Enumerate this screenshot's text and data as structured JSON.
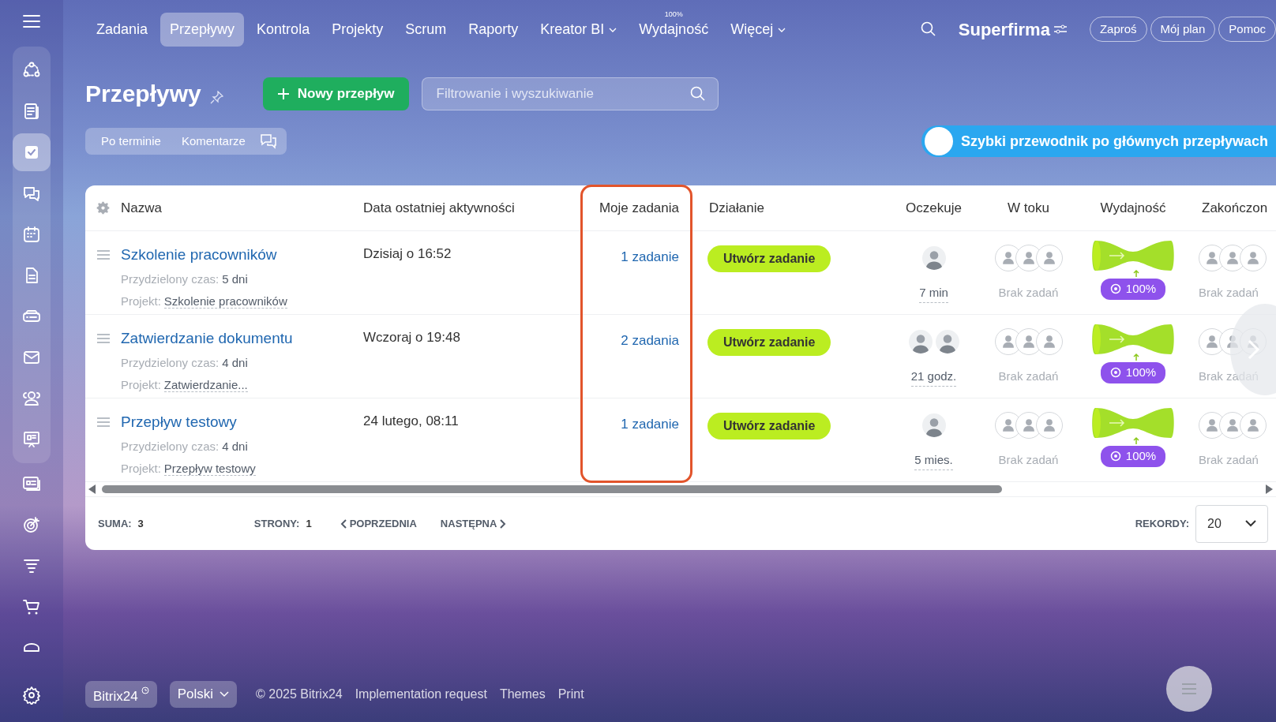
{
  "sidebar": {
    "items": [
      {
        "selected": false
      },
      {
        "selected": false
      },
      {
        "selected": true
      },
      {
        "selected": false
      },
      {
        "selected": false
      },
      {
        "selected": false
      },
      {
        "selected": false
      },
      {
        "selected": false
      },
      {
        "selected": false
      },
      {
        "selected": false
      },
      {
        "selected": false
      },
      {
        "selected": false
      },
      {
        "selected": false
      },
      {
        "selected": false
      },
      {
        "selected": false
      }
    ]
  },
  "nav": {
    "items": [
      {
        "label": "Zadania",
        "selected": false,
        "dropdown": false
      },
      {
        "label": "Przepływy",
        "selected": true,
        "dropdown": false
      },
      {
        "label": "Kontrola",
        "selected": false,
        "dropdown": false
      },
      {
        "label": "Projekty",
        "selected": false,
        "dropdown": false
      },
      {
        "label": "Scrum",
        "selected": false,
        "dropdown": false
      },
      {
        "label": "Raporty",
        "selected": false,
        "dropdown": false
      },
      {
        "label": "Kreator BI",
        "selected": false,
        "dropdown": true
      },
      {
        "label": "Wydajność",
        "selected": false,
        "dropdown": false,
        "superscript": "100%"
      },
      {
        "label": "Więcej",
        "selected": false,
        "dropdown": true
      }
    ],
    "company": "Superfirma",
    "buttons": [
      "Zaproś",
      "Mój plan",
      "Pomoc"
    ]
  },
  "page": {
    "title": "Przepływy",
    "new_button": "Nowy przepływ",
    "search": {
      "placeholder": "Filtrowanie i wyszukiwanie"
    },
    "filters": [
      "Po terminie",
      "Komentarze"
    ],
    "guide_banner": "Szybki przewodnik po głównych przepływach"
  },
  "table": {
    "columns": [
      {
        "label": "Nazwa",
        "highlighted": false
      },
      {
        "label": "Data ostatniej aktywności",
        "highlighted": false
      },
      {
        "label": "Moje zadania",
        "highlighted": true
      },
      {
        "label": "Działanie",
        "highlighted": false
      },
      {
        "label": "Oczekuje",
        "highlighted": false
      },
      {
        "label": "W toku",
        "highlighted": false
      },
      {
        "label": "Wydajność",
        "highlighted": false
      },
      {
        "label": "Zakończon",
        "highlighted": false
      }
    ],
    "rows": [
      {
        "name": "Szkolenie pracowników",
        "time_label": "Przydzielony czas:",
        "time": "5 dni",
        "project_label": "Projekt:",
        "project": "Szkolenie pracowników",
        "last_activity": "Dzisiaj o 16:52",
        "my_tasks": "1 zadanie",
        "action": "Utwórz zadanie",
        "waiting_people": [
          {
            "kind": "photo"
          }
        ],
        "waiting_time": "7 min",
        "in_progress": "Brak zadań",
        "efficiency": "100%",
        "completed": "Brak zadań"
      },
      {
        "name": "Zatwierdzanie dokumentu",
        "time_label": "Przydzielony czas:",
        "time": "4 dni",
        "project_label": "Projekt:",
        "project": "Zatwierdzanie...",
        "last_activity": "Wczoraj o 19:48",
        "my_tasks": "2 zadania",
        "action": "Utwórz zadanie",
        "waiting_people": [
          {
            "kind": "photo"
          },
          {
            "kind": "photo"
          }
        ],
        "waiting_time": "21 godz.",
        "in_progress": "Brak zadań",
        "efficiency": "100%",
        "completed": "Brak zadań"
      },
      {
        "name": "Przepływ testowy",
        "time_label": "Przydzielony czas:",
        "time": "4 dni",
        "project_label": "Projekt:",
        "project": "Przepływ testowy",
        "last_activity": "24 lutego, 08:11",
        "my_tasks": "1 zadanie",
        "action": "Utwórz zadanie",
        "waiting_people": [
          {
            "kind": "photo"
          }
        ],
        "waiting_time": "5 mies.",
        "in_progress": "Brak zadań",
        "efficiency": "100%",
        "completed": "Brak zadań"
      }
    ],
    "footer": {
      "total_label": "SUMA:",
      "total": "3",
      "pages_label": "STRONY:",
      "pages": "1",
      "prev": "POPRZEDNIA",
      "next": "NASTĘPNA",
      "records_label": "REKORDY:",
      "records": "20"
    }
  },
  "page_footer": {
    "brand": "Bitrix24",
    "language": "Polski",
    "copyright": "© 2025 Bitrix24",
    "links": [
      "Implementation request",
      "Themes",
      "Print"
    ]
  }
}
